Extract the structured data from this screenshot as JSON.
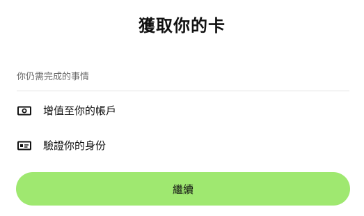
{
  "header": {
    "title": "獲取你的卡"
  },
  "tasks": {
    "section_label": "你仍需完成的事情",
    "items": [
      {
        "label": "增值至你的帳戶",
        "icon": "cash-icon"
      },
      {
        "label": "驗證你的身份",
        "icon": "id-card-icon"
      }
    ]
  },
  "footer": {
    "continue_label": "繼續"
  },
  "colors": {
    "accent": "#9fe870",
    "text": "#111111",
    "muted": "#6b6b6b",
    "divider": "#e3e3e3"
  }
}
